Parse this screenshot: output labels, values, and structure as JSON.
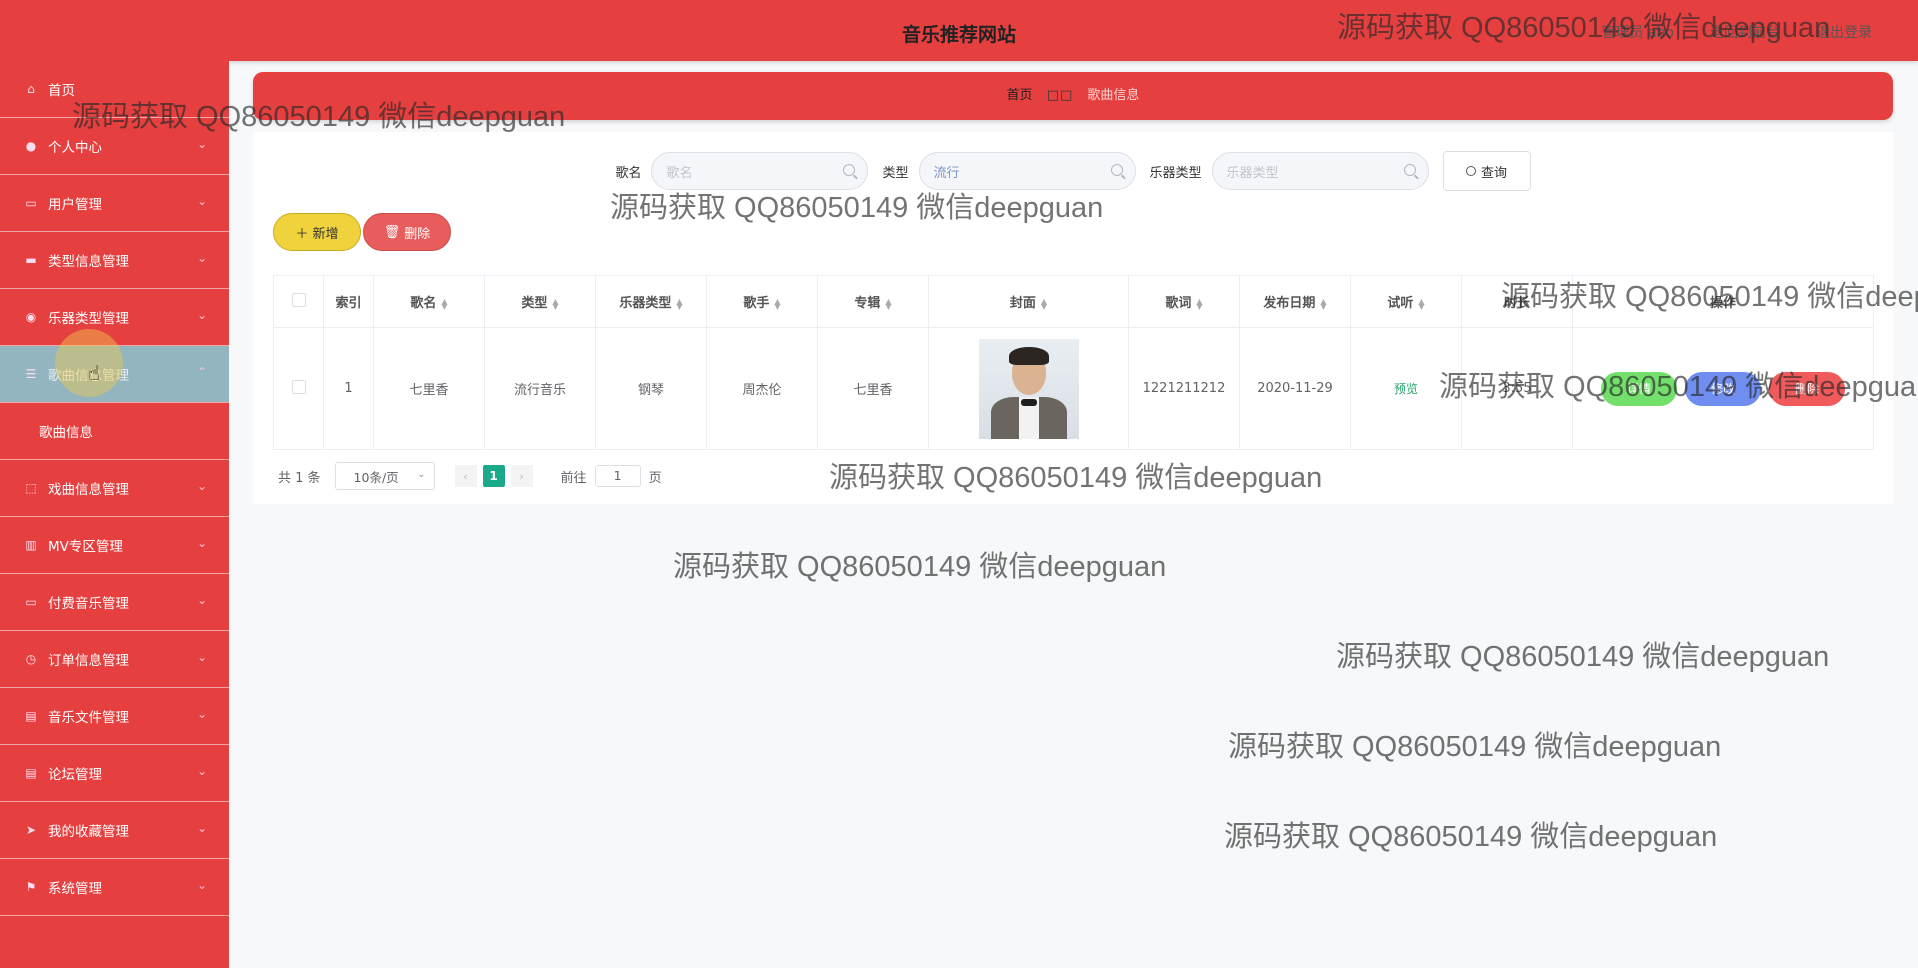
{
  "header": {
    "title": "音乐推荐网站",
    "admin_label": "管理员 abo",
    "back_label": "退回到前台",
    "logout_label": "退出登录"
  },
  "sidebar": {
    "items": [
      {
        "label": "首页",
        "icon": "home-icon",
        "has_arrow": false
      },
      {
        "label": "个人中心",
        "icon": "user-icon",
        "has_arrow": true
      },
      {
        "label": "用户管理",
        "icon": "users-icon",
        "has_arrow": true
      },
      {
        "label": "类型信息管理",
        "icon": "category-icon",
        "has_arrow": true
      },
      {
        "label": "乐器类型管理",
        "icon": "location-icon",
        "has_arrow": true
      },
      {
        "label": "歌曲信息管理",
        "icon": "sliders-icon",
        "has_arrow": true,
        "active": true
      },
      {
        "label": "歌曲信息",
        "submenu": true
      },
      {
        "label": "戏曲信息管理",
        "icon": "frame-icon",
        "has_arrow": true
      },
      {
        "label": "MV专区管理",
        "icon": "bars-icon",
        "has_arrow": true
      },
      {
        "label": "付费音乐管理",
        "icon": "monitor-icon",
        "has_arrow": true
      },
      {
        "label": "订单信息管理",
        "icon": "clock-icon",
        "has_arrow": true
      },
      {
        "label": "音乐文件管理",
        "icon": "clipboard-icon",
        "has_arrow": true
      },
      {
        "label": "论坛管理",
        "icon": "clipboard-icon",
        "has_arrow": true
      },
      {
        "label": "我的收藏管理",
        "icon": "send-icon",
        "has_arrow": true
      },
      {
        "label": "系统管理",
        "icon": "flag-icon",
        "has_arrow": true
      }
    ]
  },
  "breadcrumb": {
    "home": "首页",
    "separator": "□□",
    "current": "歌曲信息"
  },
  "search": {
    "song_label": "歌名",
    "song_placeholder": "歌名",
    "type_label": "类型",
    "type_value": "流行",
    "instrument_label": "乐器类型",
    "instrument_placeholder": "乐器类型",
    "query_button": "查询"
  },
  "actions": {
    "add": "新增",
    "delete": "删除"
  },
  "table": {
    "columns": [
      "索引",
      "歌名",
      "类型",
      "乐器类型",
      "歌手",
      "专辑",
      "封面",
      "歌词",
      "发布日期",
      "试听",
      "时长",
      "操作"
    ],
    "rows": [
      {
        "index": "1",
        "song": "七里香",
        "type": "流行音乐",
        "instrument": "钢琴",
        "singer": "周杰伦",
        "album": "七里香",
        "lyrics": "1221211212",
        "date": "2020-11-29",
        "preview": "预览",
        "duration": "3:55",
        "detail_btn": "详情",
        "edit_btn": "修改",
        "delete_btn": "删除"
      }
    ]
  },
  "pagination": {
    "total": "共 1 条",
    "page_size": "10条/页",
    "current_page": "1",
    "goto_label": "前往",
    "goto_value": "1",
    "page_unit": "页"
  },
  "watermark": "源码获取 QQ86050149 微信deepguan",
  "colors": {
    "primary_red": "#e5403f",
    "active_menu": "#92b5bf",
    "add_yellow": "#f0d23c",
    "detail_green": "#73e06c",
    "edit_blue": "#6f8ef0",
    "page_teal": "#1aa98a"
  }
}
